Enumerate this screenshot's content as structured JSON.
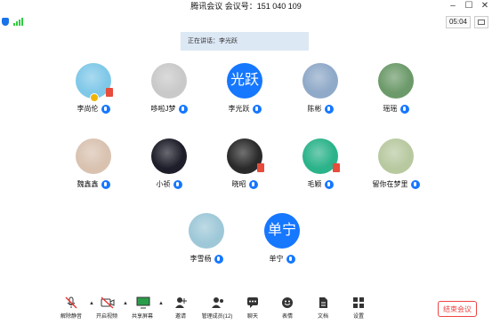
{
  "window": {
    "title": "腾讯会议 会议号：151 040 109"
  },
  "status": {
    "timer": "05:04"
  },
  "speaking": {
    "text": "正在讲话：李光跃"
  },
  "participants": [
    {
      "name": "李尚伦",
      "avatar": "photo",
      "color": "#7fc8e8"
    },
    {
      "name": "哆啦J梦",
      "avatar": "photo",
      "color": "#c9c9c9"
    },
    {
      "name": "李光跃",
      "avatar": "text",
      "initials": "光跃"
    },
    {
      "name": "陈彬",
      "avatar": "photo",
      "color": "#8fa9c8"
    },
    {
      "name": "瑶瑶",
      "avatar": "photo",
      "color": "#6c9a6a"
    },
    {
      "name": "魏鑫鑫",
      "avatar": "photo",
      "color": "#d9c2b0"
    },
    {
      "name": "小祯",
      "avatar": "photo",
      "color": "#1e1e2a"
    },
    {
      "name": "晓昭",
      "avatar": "photo",
      "color": "#2a2a2a"
    },
    {
      "name": "毛颖",
      "avatar": "photo",
      "color": "#2bb38a"
    },
    {
      "name": "留你在梦里",
      "avatar": "photo",
      "color": "#b8c9a0"
    },
    {
      "name": "李雪杨",
      "avatar": "photo",
      "color": "#9ec8d8"
    },
    {
      "name": "单宁",
      "avatar": "text",
      "initials": "单宁"
    }
  ],
  "toolbar": {
    "mute": "解除静音",
    "video": "开启视频",
    "share": "共享屏幕",
    "invite": "邀请",
    "members": "管理成员(12)",
    "chat": "聊天",
    "emoji": "表情",
    "docs": "文档",
    "settings": "设置"
  },
  "end_button": "结束会议",
  "colors": {
    "accent": "#1677ff",
    "danger": "#ee4444",
    "banner": "#dde8f5"
  }
}
